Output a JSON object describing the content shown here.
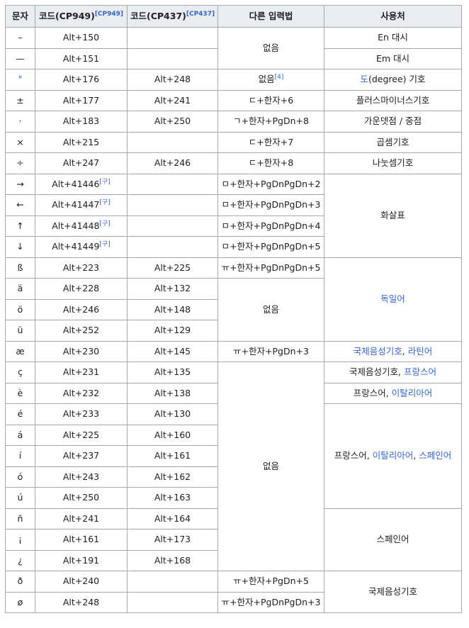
{
  "headers": [
    {
      "text": "문자",
      "sup": ""
    },
    {
      "text": "코드(CP949)",
      "sup": "[CP949]"
    },
    {
      "text": "코드(CP437)",
      "sup": "[CP437]"
    },
    {
      "text": "다른 입력법",
      "sup": ""
    },
    {
      "text": "사용처",
      "sup": ""
    }
  ],
  "rows": [
    {
      "char": "–",
      "cp949": "Alt+150",
      "cp437": "",
      "input": {
        "text": "없음",
        "rowspan": 2
      },
      "usage": {
        "parts": [
          {
            "t": "En 대시"
          }
        ]
      }
    },
    {
      "char": "—",
      "cp949": "Alt+151",
      "cp437": "",
      "usage": {
        "parts": [
          {
            "t": "Em 대시"
          }
        ]
      }
    },
    {
      "char": "°",
      "link_char": true,
      "cp949": "Alt+176",
      "cp437": "Alt+248",
      "input": {
        "text": "없음",
        "sup": "[4]"
      },
      "usage": {
        "parts": [
          {
            "t": "도",
            "link": true
          },
          {
            "t": "(degree) 기호"
          }
        ]
      }
    },
    {
      "char": "±",
      "cp949": "Alt+177",
      "cp437": "Alt+241",
      "input": {
        "text": "ㄷ+한자+6"
      },
      "usage": {
        "parts": [
          {
            "t": "플러스마이너스기호"
          }
        ]
      }
    },
    {
      "char": "·",
      "cp949": "Alt+183",
      "cp437": "Alt+250",
      "input": {
        "text": "ㄱ+한자+PgDn+8"
      },
      "usage": {
        "parts": [
          {
            "t": "가운뎃점 / 중점"
          }
        ]
      }
    },
    {
      "char": "×",
      "cp949": "Alt+215",
      "cp437": "",
      "input": {
        "text": "ㄷ+한자+7"
      },
      "usage": {
        "parts": [
          {
            "t": "곱셈기호"
          }
        ]
      }
    },
    {
      "char": "÷",
      "cp949": "Alt+247",
      "cp437": "Alt+246",
      "input": {
        "text": "ㄷ+한자+8"
      },
      "usage": {
        "parts": [
          {
            "t": "나눗셈기호"
          }
        ]
      }
    },
    {
      "char": "→",
      "cp949": "Alt+41446",
      "cp949_sup": "[구]",
      "cp437": "",
      "input": {
        "text": "ㅁ+한자+PgDnPgDn+2"
      },
      "usage": {
        "parts": [
          {
            "t": "화살표"
          }
        ],
        "rowspan": 4
      }
    },
    {
      "char": "←",
      "cp949": "Alt+41447",
      "cp949_sup": "[구]",
      "cp437": "",
      "input": {
        "text": "ㅁ+한자+PgDnPgDn+3"
      }
    },
    {
      "char": "↑",
      "cp949": "Alt+41448",
      "cp949_sup": "[구]",
      "cp437": "",
      "input": {
        "text": "ㅁ+한자+PgDnPgDn+4"
      }
    },
    {
      "char": "↓",
      "cp949": "Alt+41449",
      "cp949_sup": "[구]",
      "cp437": "",
      "input": {
        "text": "ㅁ+한자+PgDnPgDn+5"
      }
    },
    {
      "char": "ß",
      "cp949": "Alt+223",
      "cp437": "Alt+225",
      "input": {
        "text": "ㅠ+한자+PgDnPgDn+5"
      },
      "usage": {
        "parts": [
          {
            "t": "독일어",
            "link": true
          }
        ],
        "rowspan": 4
      }
    },
    {
      "char": "ä",
      "cp949": "Alt+228",
      "cp437": "Alt+132",
      "input": {
        "text": "없음",
        "rowspan": 3
      }
    },
    {
      "char": "ö",
      "cp949": "Alt+246",
      "cp437": "Alt+148"
    },
    {
      "char": "ü",
      "cp949": "Alt+252",
      "cp437": "Alt+129"
    },
    {
      "char": "æ",
      "cp949": "Alt+230",
      "cp437": "Alt+145",
      "input": {
        "text": "ㅠ+한자+PgDn+3"
      },
      "usage": {
        "parts": [
          {
            "t": "국제음성기호",
            "link": true
          },
          {
            "t": ", "
          },
          {
            "t": "라틴어",
            "link": true
          }
        ]
      }
    },
    {
      "char": "ç",
      "cp949": "Alt+231",
      "cp437": "Alt+135",
      "input": {
        "text": "없음",
        "rowspan": 10
      },
      "usage": {
        "parts": [
          {
            "t": "국제음성기호, "
          },
          {
            "t": "프랑스어",
            "link": true
          }
        ]
      }
    },
    {
      "char": "è",
      "cp949": "Alt+232",
      "cp437": "Alt+138",
      "usage": {
        "parts": [
          {
            "t": "프랑스어, "
          },
          {
            "t": "이탈리아어",
            "link": true
          }
        ]
      }
    },
    {
      "char": "é",
      "cp949": "Alt+233",
      "cp437": "Alt+130",
      "usage": {
        "parts": [
          {
            "t": "프랑스어, "
          },
          {
            "t": "이탈리아어",
            "link": true
          },
          {
            "t": ", "
          },
          {
            "t": "스페인어",
            "link": true
          }
        ],
        "rowspan": 5
      }
    },
    {
      "char": "á",
      "cp949": "Alt+225",
      "cp437": "Alt+160"
    },
    {
      "char": "í",
      "cp949": "Alt+237",
      "cp437": "Alt+161"
    },
    {
      "char": "ó",
      "cp949": "Alt+243",
      "cp437": "Alt+162"
    },
    {
      "char": "ú",
      "cp949": "Alt+250",
      "cp437": "Alt+163"
    },
    {
      "char": "ñ",
      "cp949": "Alt+241",
      "cp437": "Alt+164",
      "usage": {
        "parts": [
          {
            "t": "스페인어"
          }
        ],
        "rowspan": 3
      }
    },
    {
      "char": "¡",
      "cp949": "Alt+161",
      "cp437": "Alt+173"
    },
    {
      "char": "¿",
      "cp949": "Alt+191",
      "cp437": "Alt+168"
    },
    {
      "char": "ð",
      "cp949": "Alt+240",
      "cp437": "",
      "input": {
        "text": "ㅠ+한자+PgDn+5"
      },
      "usage": {
        "parts": [
          {
            "t": "국제음성기호"
          }
        ],
        "rowspan": 2
      }
    },
    {
      "char": "ø",
      "cp949": "Alt+248",
      "cp437": "",
      "input": {
        "text": "ㅠ+한자+PgDnPgDn+3"
      }
    }
  ],
  "colors": {
    "link": "#3366cc",
    "header_bg": "#eaecf0",
    "border": "#a2a9b1"
  }
}
